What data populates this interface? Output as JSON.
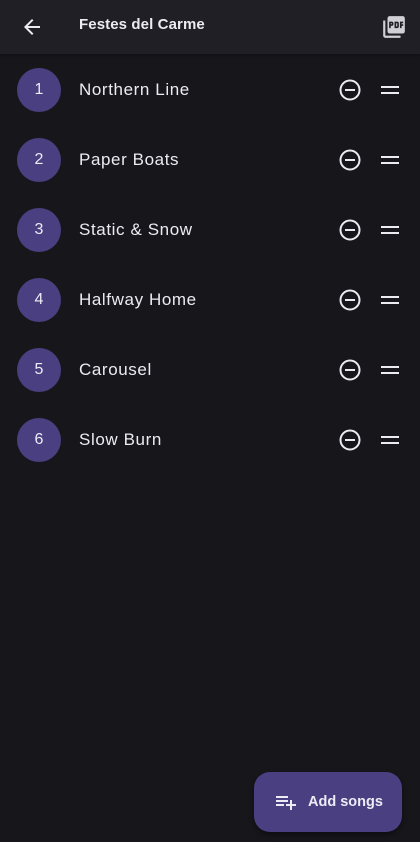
{
  "app_bar": {
    "title": "Festes del Carme",
    "back_icon": "arrow-left-icon",
    "pdf_icon": "pdf-export-icon"
  },
  "songs": [
    {
      "number": "1",
      "title": "Northern Line"
    },
    {
      "number": "2",
      "title": "Paper Boats"
    },
    {
      "number": "3",
      "title": "Static & Snow"
    },
    {
      "number": "4",
      "title": "Halfway Home"
    },
    {
      "number": "5",
      "title": "Carousel"
    },
    {
      "number": "6",
      "title": "Slow Burn"
    }
  ],
  "row_icons": {
    "remove": "minus-circle-icon",
    "drag": "drag-handle-icon"
  },
  "fab": {
    "label": "Add songs",
    "icon": "playlist-add-icon"
  },
  "colors": {
    "background": "#17161b",
    "app_bar": "#201f25",
    "accent": "#4a3f80",
    "text": "#ecebf1"
  }
}
